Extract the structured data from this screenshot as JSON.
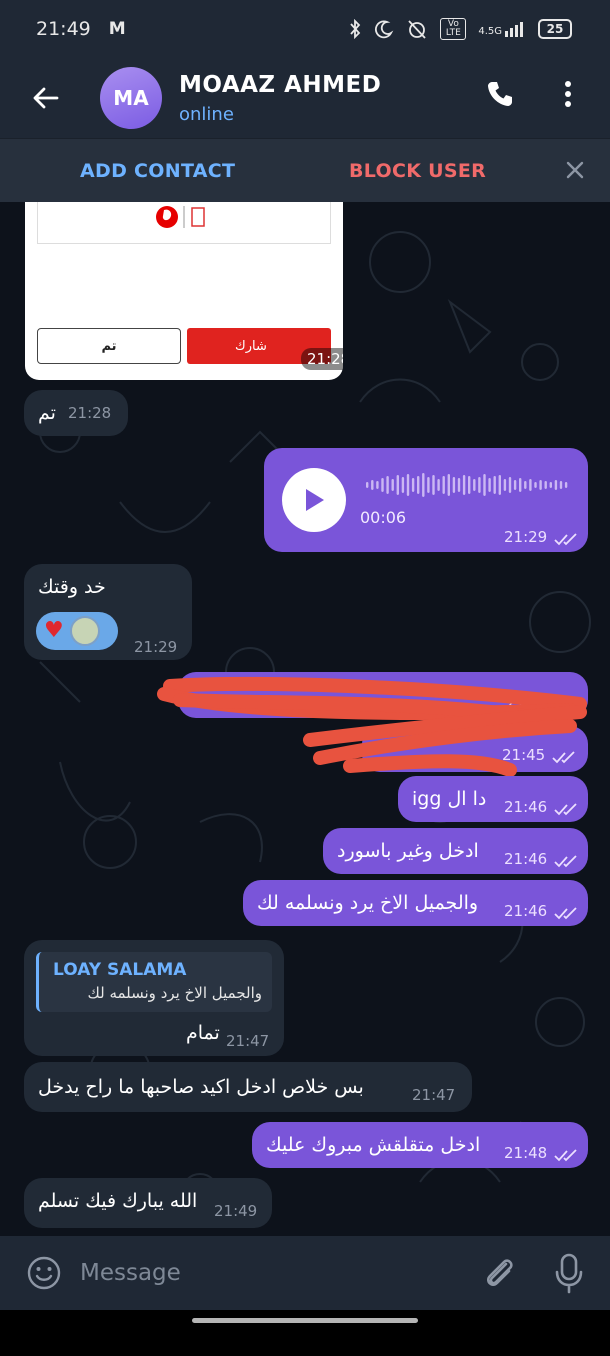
{
  "status_bar": {
    "time": "21:49",
    "carrier_icon": "M",
    "network_label": "4.5G",
    "volte_label": "Vo LTE",
    "battery": "25"
  },
  "header": {
    "avatar_initials": "MA",
    "contact_name": "MOAAZ AHMED",
    "contact_status": "online"
  },
  "action_bar": {
    "add_contact": "ADD CONTACT",
    "block_user": "BLOCK USER"
  },
  "messages": [
    {
      "type": "image",
      "direction": "in",
      "done_label": "تم",
      "share_label": "شارك",
      "time": "21:28"
    },
    {
      "type": "text",
      "direction": "in",
      "text": "تم",
      "time": "21:28"
    },
    {
      "type": "voice",
      "direction": "out",
      "duration": "00:06",
      "time": "21:29"
    },
    {
      "type": "text",
      "direction": "in",
      "text": "خد وقتك",
      "time": "21:29",
      "reactions": [
        "heart"
      ]
    },
    {
      "type": "text",
      "direction": "out",
      "text": "",
      "time": "21:45",
      "redacted": true
    },
    {
      "type": "text",
      "direction": "out",
      "text": "",
      "time": "21:45",
      "redacted": true
    },
    {
      "type": "text",
      "direction": "out",
      "text": "دا ال igg",
      "time": "21:46"
    },
    {
      "type": "text",
      "direction": "out",
      "text": "ادخل وغير باسورد",
      "time": "21:46"
    },
    {
      "type": "text",
      "direction": "out",
      "text": "والجميل الاخ يرد ونسلمه لك",
      "time": "21:46"
    },
    {
      "type": "reply",
      "direction": "in",
      "quote_name": "LOAY SALAMA",
      "quote_text": "والجميل الاخ يرد ونسلمه لك",
      "text": "تمام",
      "time": "21:47"
    },
    {
      "type": "text",
      "direction": "in",
      "text": "بس خلاص ادخل اكيد صاحبها ما راح يدخل",
      "time": "21:47"
    },
    {
      "type": "text",
      "direction": "out",
      "text": "ادخل متقلقش مبروك عليك",
      "time": "21:48"
    },
    {
      "type": "text",
      "direction": "in",
      "text": "الله يبارك فيك تسلم",
      "time": "21:49"
    }
  ],
  "input": {
    "placeholder": "Message"
  },
  "colors": {
    "accent": "#6eb2ff",
    "outgoing_bubble": "#7a55d9",
    "incoming_bubble": "#212a36",
    "danger": "#f06a6a",
    "header_bg": "#1f2835"
  }
}
